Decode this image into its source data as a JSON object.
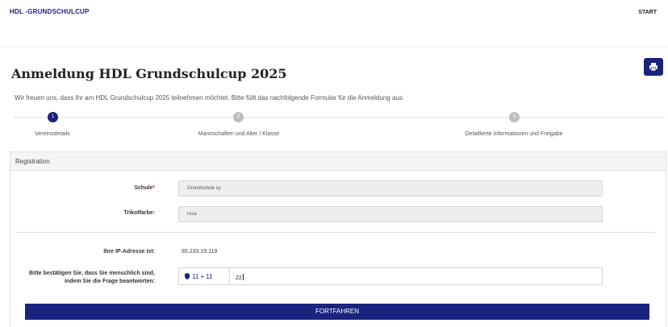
{
  "header": {
    "brand": "HDL -GRUNDSCHULCUP",
    "start_link": "START"
  },
  "page": {
    "title": "Anmeldung HDL Grundschulcup 2025",
    "intro": "Wir freuen uns, dass Ihr am HDL Grundschulcup 2025 teilnehmen möchtet. Bitte füllt das nachfolgende Formular für die Anmeldung aus.",
    "print_icon": "print-icon"
  },
  "steps": [
    {
      "number": "1",
      "label": "Vereinsdetails",
      "state": "active"
    },
    {
      "number": "2",
      "label": "Mannschaften und Alter / Klasse",
      "state": "inactive"
    },
    {
      "number": "3",
      "label": "Detaillierte Informationen und Freigabe",
      "state": "inactive"
    }
  ],
  "form": {
    "section_title": "Registration",
    "schule": {
      "label": "Schule",
      "required_mark": "*",
      "value": "Grundschule xy"
    },
    "trikotfarbe": {
      "label": "Trikotfarbe:",
      "value": "rosa"
    },
    "ip": {
      "label": "Ihre IP-Adresse ist:",
      "value": "85.233.19.119"
    },
    "captcha": {
      "label_line1": "Bitte bestätigen Sie, dass Sie menschlich sind,",
      "label_line2": "indem Sie die Frage beantworten:",
      "question": "11 + 11",
      "answer": "22",
      "icon": "shield-icon"
    },
    "submit_label": "FORTFAHREN"
  },
  "colors": {
    "primary": "#1a237e",
    "required": "#c62828",
    "step_inactive": "#bdbdbd"
  }
}
